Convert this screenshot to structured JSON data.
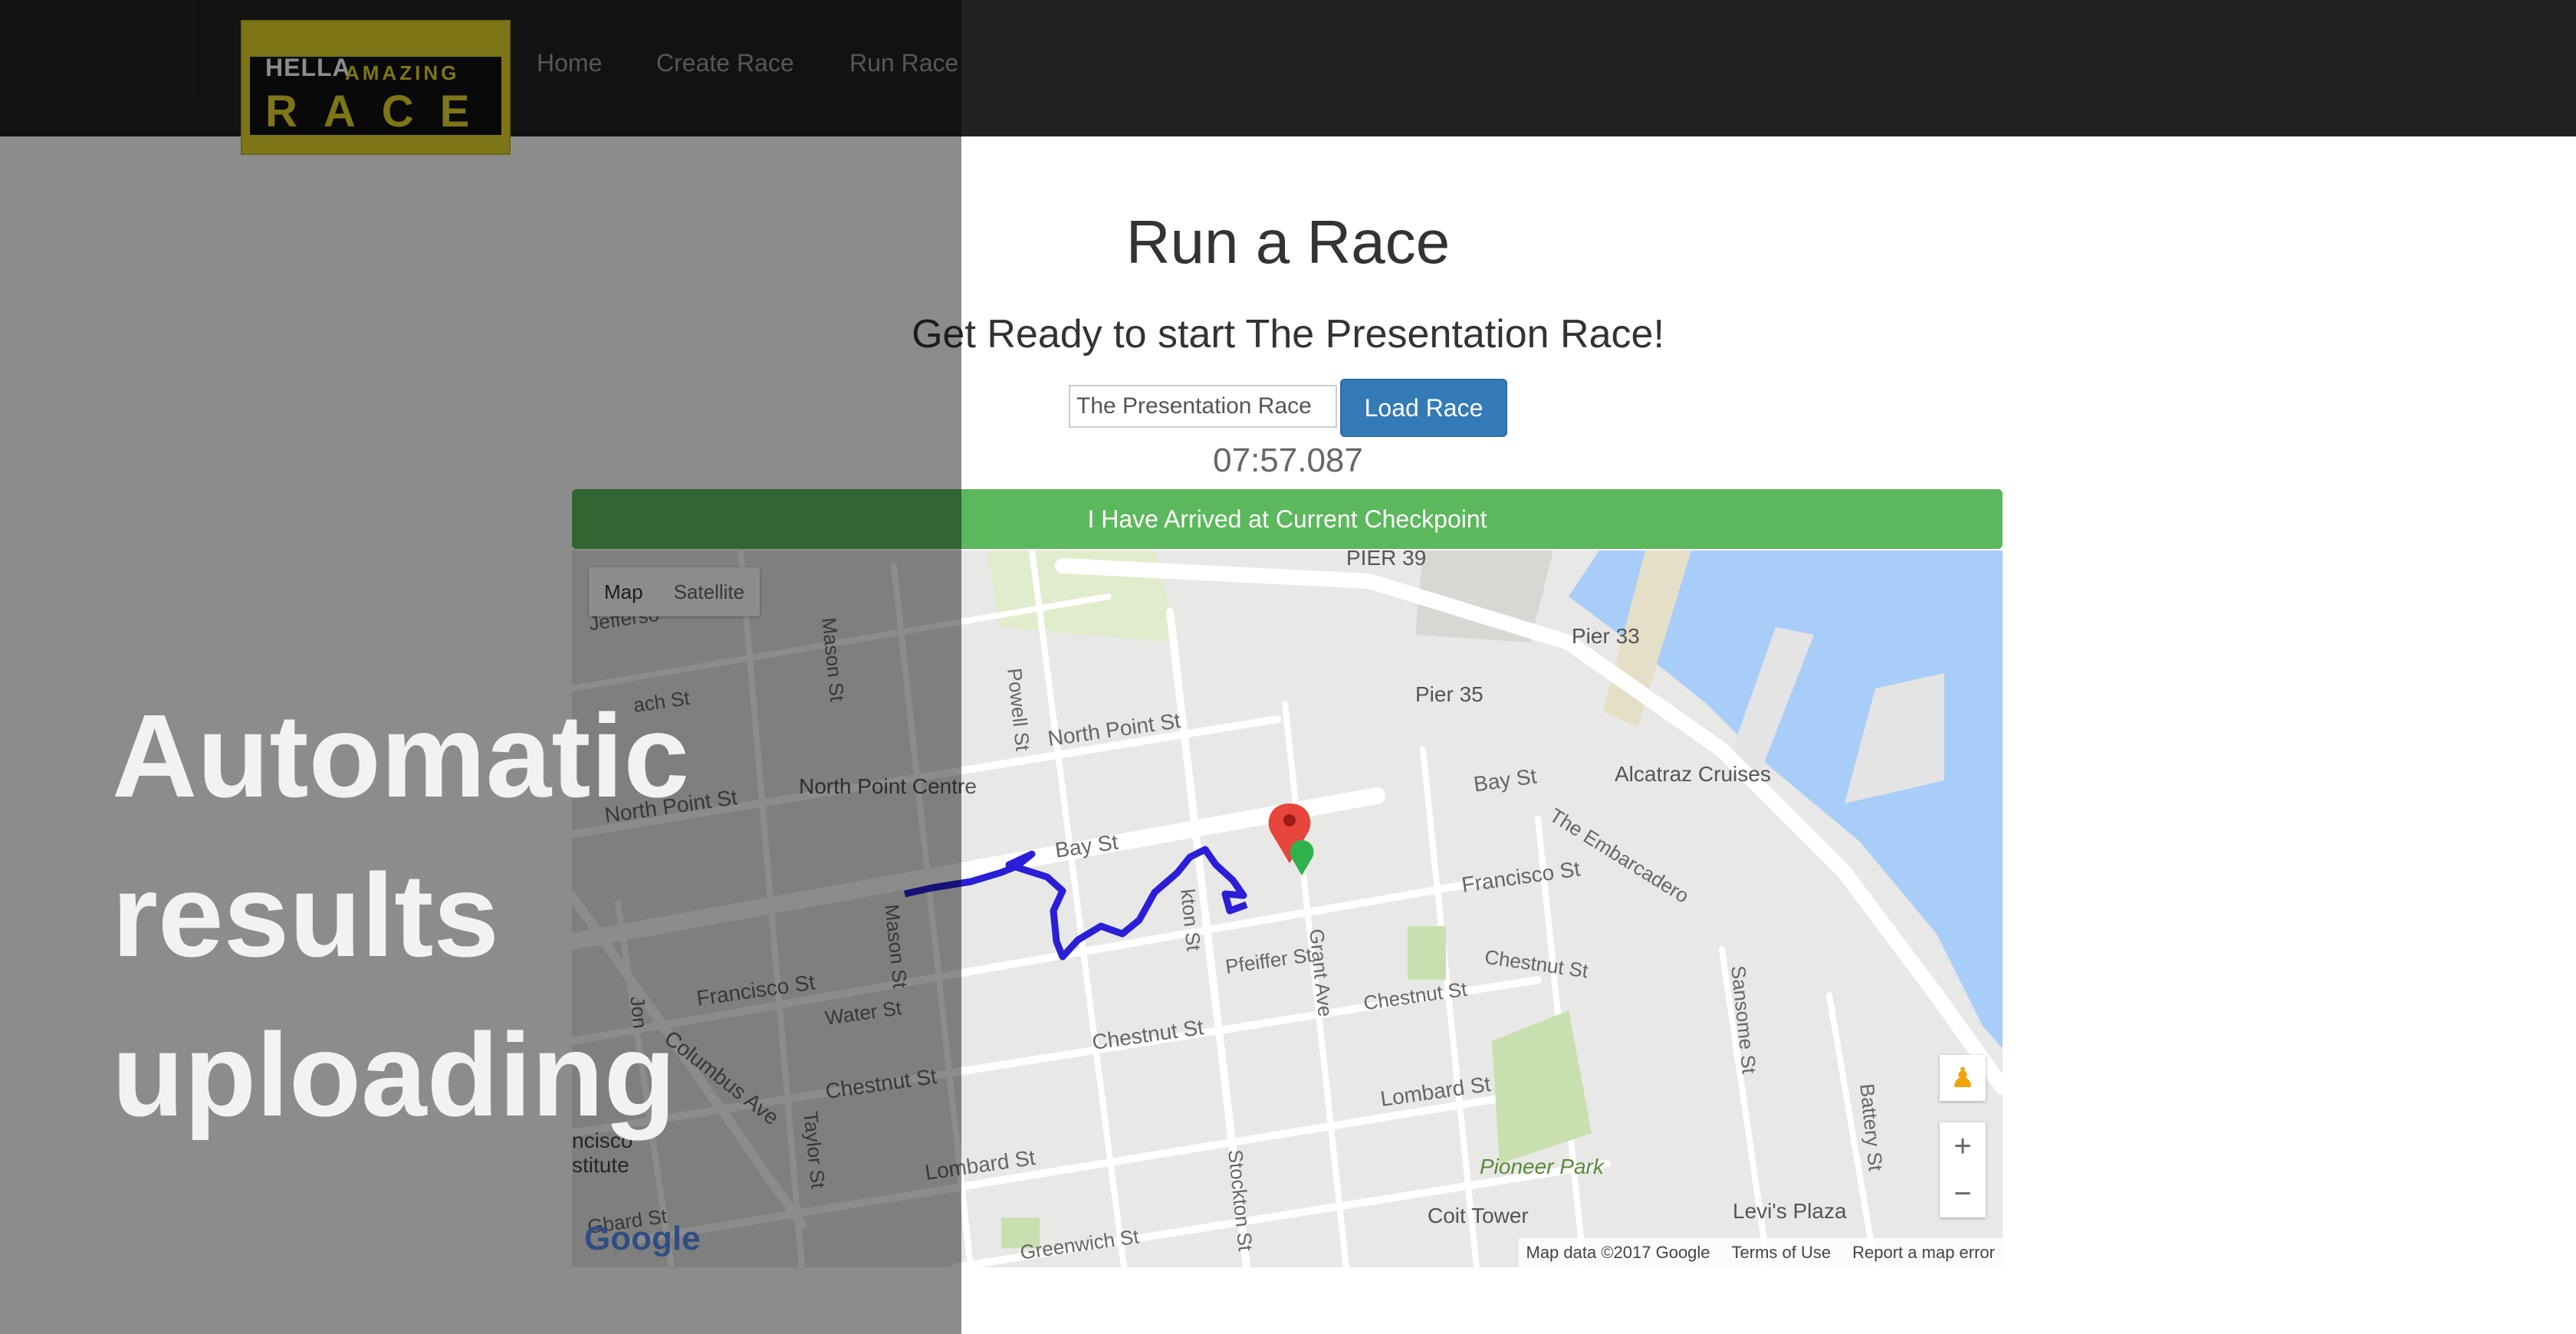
{
  "nav": {
    "logo": {
      "line1_left": "HELLA",
      "line1_right": "AMAZING",
      "line2": "RACE"
    },
    "links": [
      "Home",
      "Create Race",
      "Run Race"
    ]
  },
  "page": {
    "title": "Run a Race",
    "subtitle": "Get Ready to start The Presentation Race!",
    "race_input_value": "The Presentation Race",
    "load_button": "Load Race",
    "timer": "07:57.087",
    "arrive_button": "I Have Arrived at Current Checkpoint"
  },
  "map": {
    "type_map": "Map",
    "type_satellite": "Satellite",
    "zoom_in": "+",
    "zoom_out": "−",
    "google": "Google",
    "footer": [
      "Map data ©2017 Google",
      "Terms of Use",
      "Report a map error"
    ],
    "labels": {
      "pier39": "PIER 39",
      "pier33": "Pier 33",
      "pier35": "Pier 35",
      "alcatraz": "Alcatraz Cruises",
      "embarcadero": "The Embarcadero",
      "north_point_st": "North Point St",
      "north_point_st_2": "North Point St",
      "north_point_centre": "North Point Centre",
      "bay_st": "Bay St",
      "bay_st_2": "Bay St",
      "francisco_st": "Francisco St",
      "francisco_st_2": "Francisco St",
      "chestnut_st": "Chestnut St",
      "chestnut_st_2": "Chestnut St",
      "chestnut_st_3": "Chestnut St",
      "chestnut_st_4": "Chestnut St",
      "lombard_st": "Lombard St",
      "lombard_st_2": "Lombard St",
      "water_st": "Water St",
      "columbus_ave": "Columbus Ave",
      "mason_st": "Mason St",
      "mason_st_2": "Mason St",
      "powell_st": "Powell St",
      "stockton_st": "kton St",
      "stockton_st_2": "Stockton St",
      "grant_ave": "Grant Ave",
      "pfeiffer_st": "Pfeiffer St",
      "sansome_st": "Sansome St",
      "battery_st": "Battery St",
      "taylor_st": "Taylor St",
      "jones": "Jon",
      "jefferson": "Jefferso",
      "beach_st": "ach St",
      "greenwich_st": "Greenwich St",
      "gbard_st": "Gbard St",
      "pioneer_park": "Pioneer Park",
      "coit_tower": "Coit Tower",
      "levis_plaza": "Levi's Plaza",
      "francisco_inst_1": "ncisco",
      "francisco_inst_2": "stitute"
    }
  },
  "overlay": {
    "caption": [
      "Automatic",
      "results",
      "uploading"
    ]
  },
  "colors": {
    "navbar": "#222222",
    "primary": "#337ab7",
    "success": "#5cb85c",
    "route": "#2a1fd6",
    "water": "#a9cdf9"
  }
}
